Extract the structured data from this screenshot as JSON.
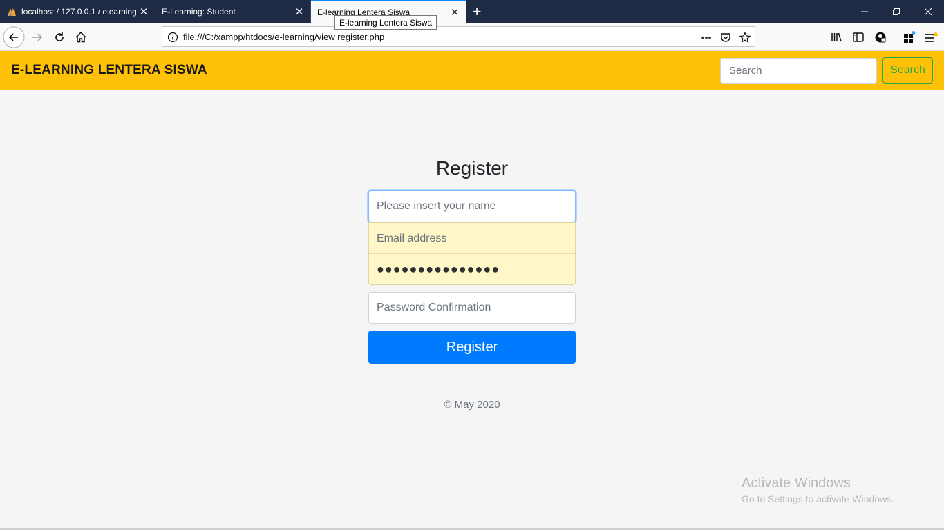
{
  "browser": {
    "tabs": [
      {
        "label": "localhost / 127.0.0.1 / elearning"
      },
      {
        "label": "E-Learning: Student"
      },
      {
        "label": "E-learning Lentera Siswa"
      }
    ],
    "tooltip": "E-learning Lentera Siswa",
    "url": "file:///C:/xampp/htdocs/e-learning/view register.php",
    "page_actions_label": "•••"
  },
  "header": {
    "brand": "E-LEARNING LENTERA SISWA",
    "search_placeholder": "Search",
    "search_button": "Search"
  },
  "form": {
    "title": "Register",
    "name_placeholder": "Please insert your name",
    "email_placeholder": "Email address",
    "password_value": "●●●●●●●●●●●●●●●",
    "confirm_placeholder": "Password Confirmation",
    "submit_label": "Register"
  },
  "footer": {
    "text": "© May 2020"
  },
  "watermark": {
    "line1": "Activate Windows",
    "line2": "Go to Settings to activate Windows."
  },
  "colors": {
    "header_bg": "#ffc107",
    "primary": "#007bff",
    "success": "#28a745",
    "autofill": "#fff7c7"
  }
}
